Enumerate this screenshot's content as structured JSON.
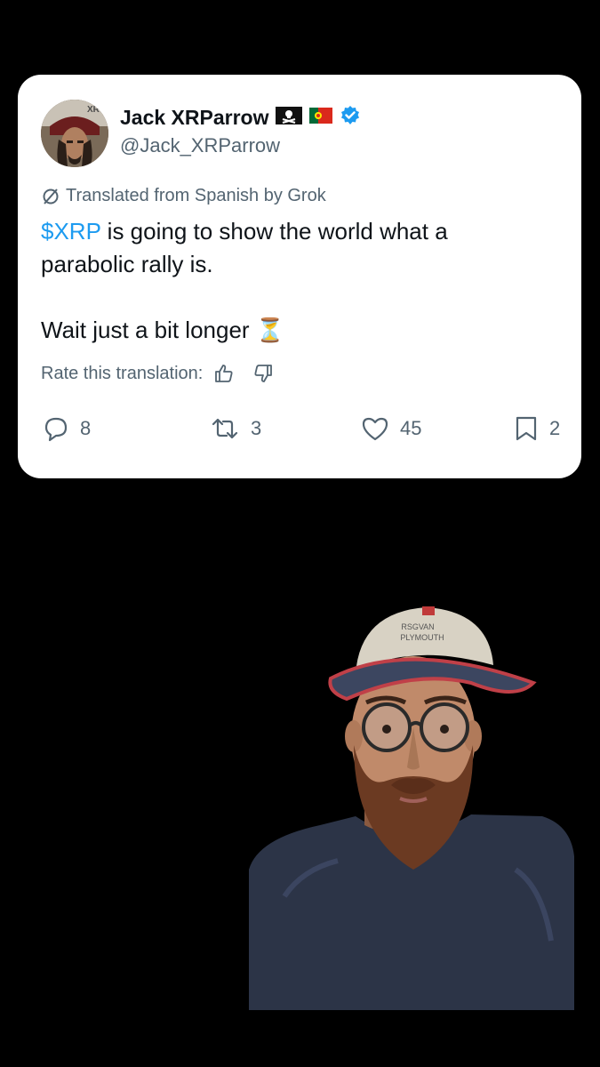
{
  "tweet": {
    "display_name": "Jack XRParrow",
    "handle": "@Jack_XRParrow",
    "avatar_text": "XR",
    "translation_note": "Translated from Spanish by Grok",
    "cashtag": "$XRP",
    "line1_rest": " is going to show the world what a",
    "line2": "parabolic rally is.",
    "line3": "Wait just a bit longer ⏳",
    "rate_label": "Rate this translation:",
    "replies": "8",
    "reposts": "3",
    "likes": "45",
    "bookmarks": "2",
    "colors": {
      "link": "#1d9bf0",
      "secondary": "#536471",
      "verified": "#1d9bf0"
    }
  },
  "overlay": {
    "cap_text_line1": "RSGVAN",
    "cap_text_line2": "PLYMOUTH"
  }
}
